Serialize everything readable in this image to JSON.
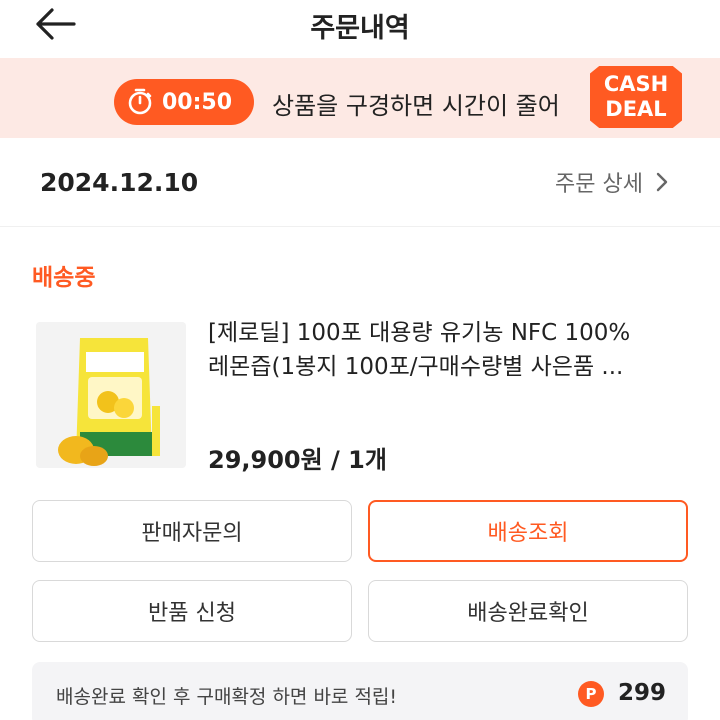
{
  "header": {
    "title": "주문내역"
  },
  "banner": {
    "timer": "00:50",
    "message": "상품을 구경하면 시간이 줄어",
    "badge_line1": "CASH",
    "badge_line2": "DEAL"
  },
  "order": {
    "date": "2024.12.10",
    "detail_link": "주문 상세",
    "status": "배송중",
    "product": {
      "name_line1": "[제로딜] 100포 대용량 유기농 NFC 100%",
      "name_line2": "레몬즙(1봉지 100포/구매수량별 사은품 ...",
      "price": "29,900원 / 1개"
    }
  },
  "actions": {
    "seller_inquiry": "판매자문의",
    "track_delivery": "배송조회",
    "return_request": "반품 신청",
    "confirm_delivery": "배송완료확인"
  },
  "reward": {
    "message": "배송완료 확인 후 구매확정 하면 바로 적립!",
    "point_symbol": "P",
    "points": "299"
  },
  "colors": {
    "accent": "#ff5a22",
    "banner_bg": "#fde9e4"
  }
}
